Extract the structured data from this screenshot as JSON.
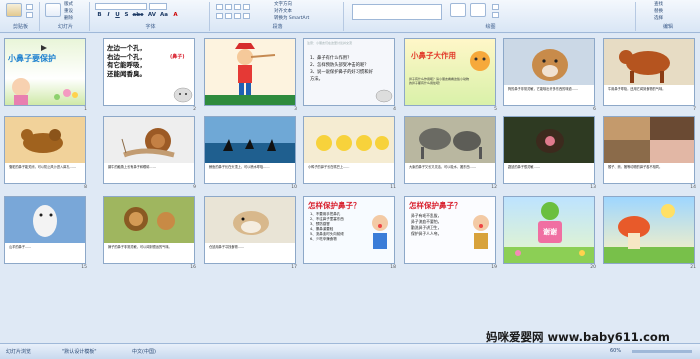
{
  "ribbon": {
    "groups": [
      "剪贴板",
      "幻灯片",
      "字体",
      "段落",
      "绘图",
      "编辑"
    ],
    "new_slide": "新建\n幻灯片",
    "layout": "版式",
    "reset": "重设",
    "delete": "删除",
    "find": "查找",
    "replace": "替换",
    "select": "选择",
    "text_direction": "文字方向",
    "align_text": "对齐文本",
    "smartart": "转换为 SmartArt",
    "font_buttons": [
      "B",
      "I",
      "U",
      "S",
      "abc",
      "AV",
      "Aa",
      "A"
    ]
  },
  "slides": [
    {
      "num": "1",
      "title": "小鼻子要保护"
    },
    {
      "num": "2",
      "poem": [
        "左边一个孔，",
        "右边一个孔，",
        "有它能呼吸，",
        "还能闻香臭。"
      ],
      "answer": "(鼻子)"
    },
    {
      "num": "3"
    },
    {
      "num": "4",
      "questions": [
        "1、鼻子有什么作用？",
        "2、怎样预防头部受冲击的呢？",
        "3、说一说保护鼻子的好习惯和好方法。"
      ],
      "header": "注意：小朋友们在这里讨论并交流"
    },
    {
      "num": "5",
      "title": "小鼻子大作用",
      "sub": "鼻子有什么作用呢？请小朋友看看这些小动物的鼻子都有什么用处吧！"
    },
    {
      "num": "6",
      "caption": "狗的鼻子非常灵敏，它能嗅出许多东西的味道……"
    },
    {
      "num": "7",
      "caption": "牛用鼻子呼吸，还用它闻到食物的气味。"
    },
    {
      "num": "8",
      "caption": "骆驼的鼻子能关闭，可以防止风沙进入鼻孔……"
    },
    {
      "num": "9",
      "caption": "蜗牛的触角上长有鼻子和眼睛……"
    },
    {
      "num": "10",
      "caption": "鲸鱼的鼻子长在头顶上，可以喷水呼吸……"
    },
    {
      "num": "11",
      "caption": "小鸭子的鼻子长在嘴巴上……"
    },
    {
      "num": "12",
      "caption": "大象的鼻子又长又灵活，可以吸水、搬东西……"
    },
    {
      "num": "13",
      "caption": "鼹鼠的鼻子很灵敏……"
    },
    {
      "num": "14",
      "caption": "猴子、熊、猪等动物的鼻子各不相同。"
    },
    {
      "num": "15",
      "caption": "山羊的鼻子……"
    },
    {
      "num": "16",
      "caption": "狮子的鼻子非常灵敏，可以闻到很远的气味。"
    },
    {
      "num": "17",
      "caption": "仓鼠用鼻子寻找食物……"
    },
    {
      "num": "18",
      "title": "怎样保护鼻子？",
      "items": [
        "1、不要用手挖鼻孔",
        "2、不往鼻子里塞东西",
        "3、预防感冒",
        "4、擦鼻涕要轻",
        "5、流鼻血时头向前倾",
        "6、少吃辛辣食物"
      ]
    },
    {
      "num": "19",
      "title": "怎样保护鼻子？",
      "items": [
        "鼻子有毛不乱拔，",
        "鼻子流血不要怕，",
        "勤洗鼻子讲卫生，",
        "保护鼻子人人夸。"
      ]
    },
    {
      "num": "20",
      "thanks": "谢谢"
    },
    {
      "num": "21"
    }
  ],
  "status": {
    "slide_info": "幻灯片浏览",
    "theme": "\"默认设计模板\"",
    "lang": "中文(中国)",
    "zoom": "60%"
  },
  "watermark": "妈咪爱婴网 www.baby611.com"
}
